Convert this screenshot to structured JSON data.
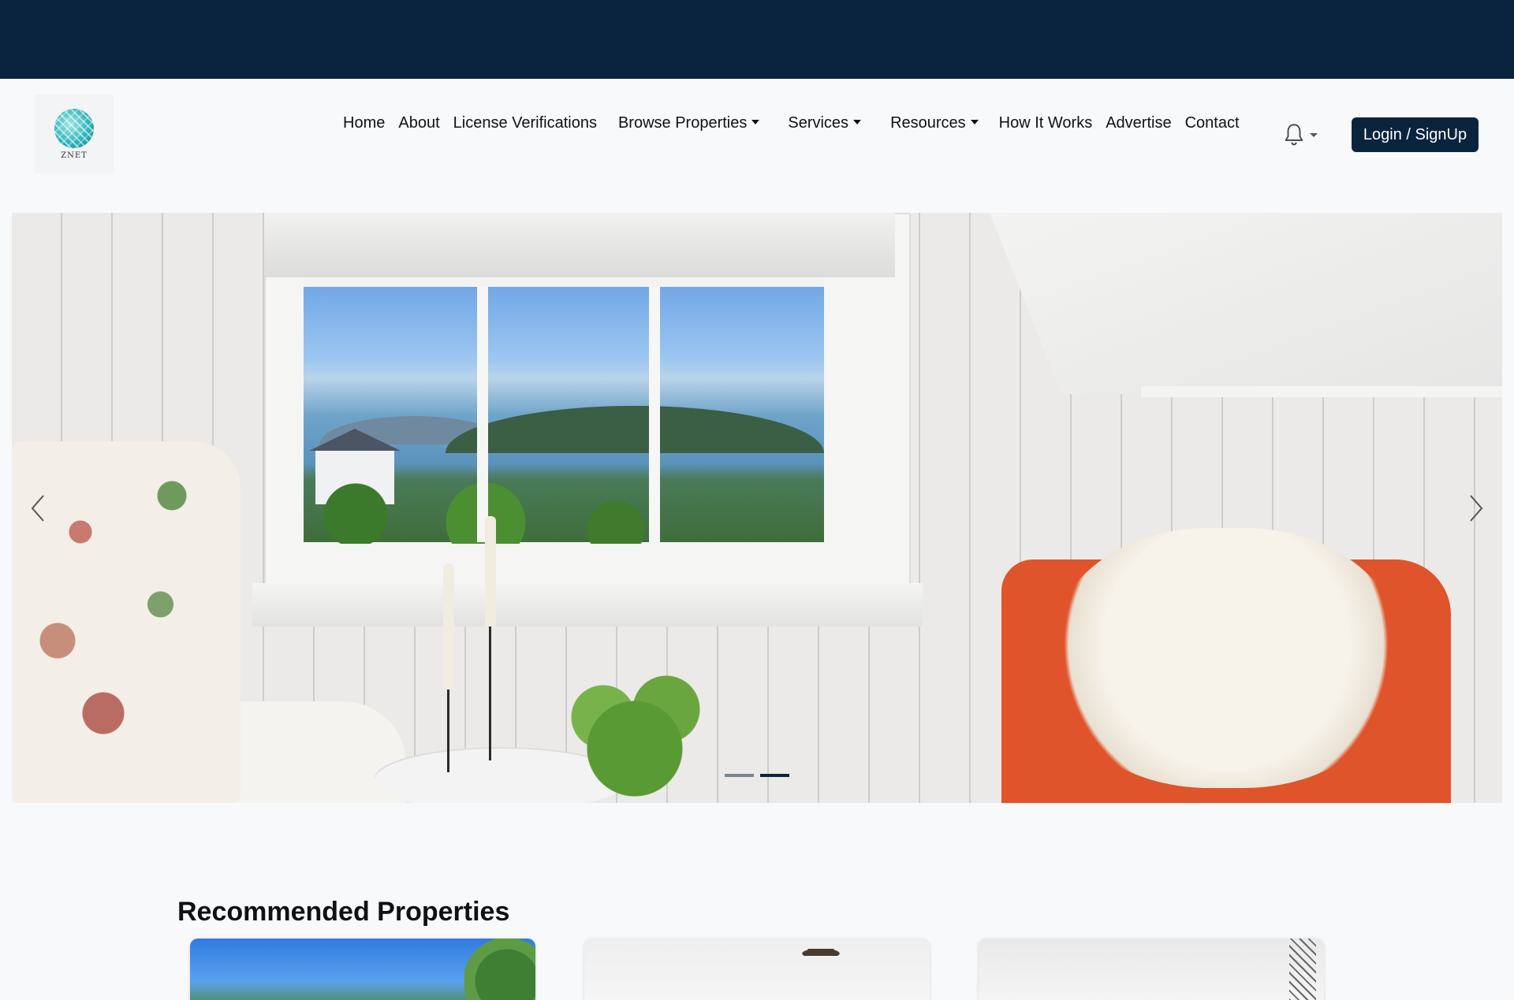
{
  "brand": {
    "logo_text": "ZNET",
    "colors": {
      "primary": "#0b243d",
      "accent": "#2ab3b8"
    }
  },
  "nav": {
    "items": [
      {
        "label": "Home",
        "dropdown": false
      },
      {
        "label": "About",
        "dropdown": false
      },
      {
        "label": "License Verifications",
        "dropdown": false
      },
      {
        "label": "Browse Properties",
        "dropdown": true
      },
      {
        "label": "Services",
        "dropdown": true
      },
      {
        "label": "Resources",
        "dropdown": true
      },
      {
        "label": "How It Works",
        "dropdown": false
      },
      {
        "label": "Advertise",
        "dropdown": false
      },
      {
        "label": "Contact",
        "dropdown": false
      }
    ],
    "notification_icon": "bell-icon",
    "login_label": "Login / SignUp"
  },
  "hero": {
    "slide_count": 2,
    "active_slide": 2,
    "prev_icon": "chevron-left-icon",
    "next_icon": "chevron-right-icon"
  },
  "recommended": {
    "title": "Recommended Properties",
    "cards": [
      {
        "image": "house-exterior-photo"
      },
      {
        "image": "room-with-ceiling-fan-photo"
      },
      {
        "image": "white-room-photo"
      }
    ]
  }
}
